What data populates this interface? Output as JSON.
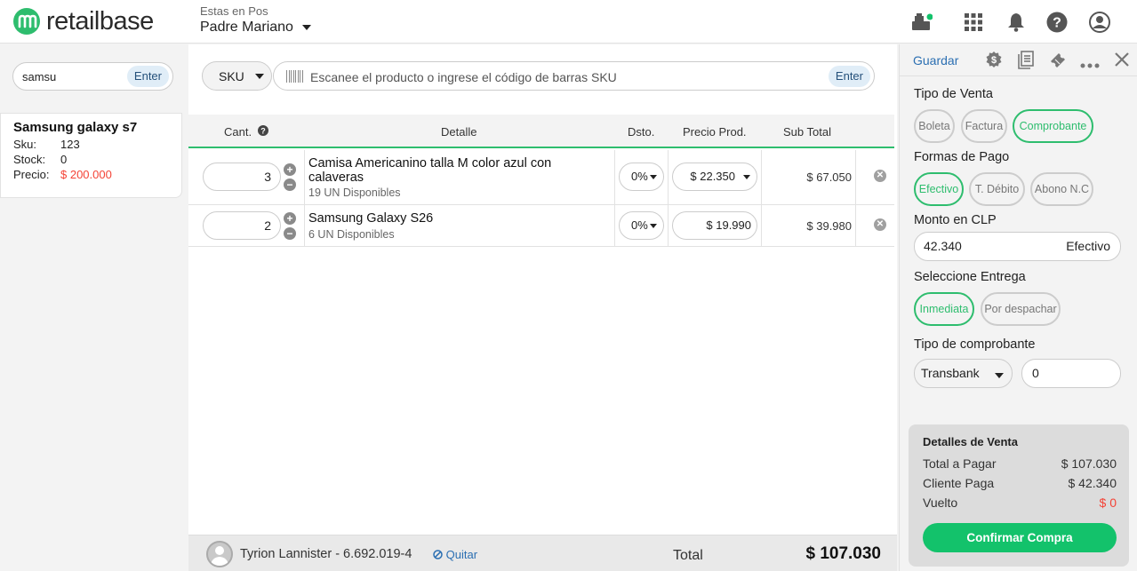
{
  "brand": {
    "name": "retailbase",
    "accent": "#2ebd6e"
  },
  "store": {
    "label": "Estas en Pos",
    "name": "Padre Mariano"
  },
  "top_icons": [
    "cash-register-icon",
    "apps-grid-icon",
    "bell-icon",
    "help-icon",
    "user-icon"
  ],
  "left": {
    "search_value": "samsu",
    "enter_label": "Enter",
    "result": {
      "title": "Samsung galaxy s7",
      "sku_label": "Sku:",
      "sku": "123",
      "stock_label": "Stock:",
      "stock": "0",
      "price_label": "Precio:",
      "price": "$ 200.000"
    }
  },
  "center": {
    "sku_select": "SKU",
    "scan_placeholder": "Escanee el producto o ingrese el código de barras SKU",
    "enter_label": "Enter",
    "columns": {
      "qty": "Cant.",
      "detail": "Detalle",
      "discount": "Dsto.",
      "price": "Precio Prod.",
      "subtotal": "Sub Total"
    },
    "rows": [
      {
        "qty": "3",
        "name": "Camisa Americanino talla M color azul con calaveras",
        "stock": "19 UN Disponibles",
        "discount": "0%",
        "price": "$ 22.350",
        "subtotal": "$ 67.050"
      },
      {
        "qty": "2",
        "name": "Samsung Galaxy S26",
        "stock": "6 UN Disponibles",
        "discount": "0%",
        "price": "$ 19.990",
        "subtotal": "$ 39.980"
      }
    ],
    "customer": "Tyrion Lannister - 6.692.019-4",
    "remove_label": "Quitar",
    "total_label": "Total",
    "total_value": "$ 107.030"
  },
  "right": {
    "save_label": "Guardar",
    "sale_type_label": "Tipo de Venta",
    "sale_types": [
      "Boleta",
      "Factura",
      "Comprobante"
    ],
    "payment_label": "Formas de Pago",
    "payments": [
      "Efectivo",
      "T. Débito",
      "Abono N.C"
    ],
    "amount_label": "Monto en CLP",
    "amount_value": "42.340",
    "amount_method": "Efectivo",
    "delivery_label": "Seleccione Entrega",
    "deliveries": [
      "Inmediata",
      "Por despachar"
    ],
    "voucher_label": "Tipo de comprobante",
    "voucher_type": "Transbank",
    "voucher_number": "0",
    "summary": {
      "title": "Detalles de Venta",
      "to_pay_label": "Total a Pagar",
      "to_pay": "$ 107.030",
      "client_pays_label": "Cliente Paga",
      "client_pays": "$ 42.340",
      "change_label": "Vuelto",
      "change": "$ 0",
      "confirm_label": "Confirmar Compra"
    }
  }
}
